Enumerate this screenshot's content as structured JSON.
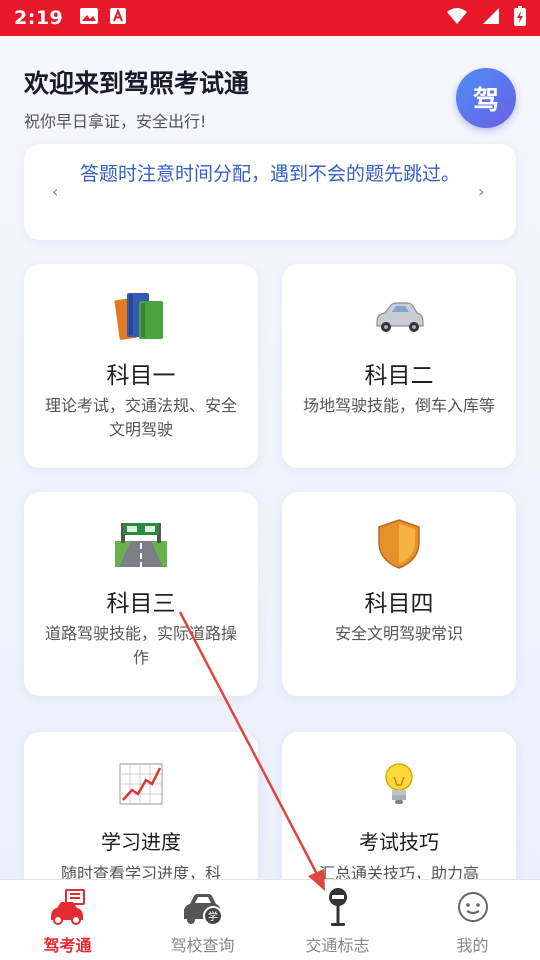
{
  "status_bar": {
    "time": "2:19",
    "left_icons": [
      "image-icon",
      "font-download-icon"
    ],
    "right_icons": [
      "wifi-icon",
      "signal-icon",
      "battery-icon"
    ],
    "color": "#e8182a"
  },
  "header": {
    "title": "欢迎来到驾照考试通",
    "subtitle": "祝你早日拿证，安全出行!",
    "avatar_text": "驾"
  },
  "tip": {
    "text": "答题时注意时间分配，遇到不会的题先跳过。",
    "prev": "‹",
    "next": "›"
  },
  "cards": [
    {
      "title": "科目一",
      "desc": "理论考试，交通法规、安全文明驾驶",
      "icon": "books-icon"
    },
    {
      "title": "科目二",
      "desc": "场地驾驶技能，倒车入库等",
      "icon": "car-icon"
    },
    {
      "title": "科目三",
      "desc": "道路驾驶技能，实际道路操作",
      "icon": "road-icon"
    },
    {
      "title": "科目四",
      "desc": "安全文明驾驶常识",
      "icon": "shield-icon"
    },
    {
      "title": "学习进度",
      "desc": "随时查看学习进度，科",
      "icon": "chart-icon"
    },
    {
      "title": "考试技巧",
      "desc": "汇总通关技巧，助力高",
      "icon": "lightbulb-icon"
    }
  ],
  "tabs": [
    {
      "label": "驾考通",
      "icon": "exam-car-icon",
      "active": true
    },
    {
      "label": "驾校查询",
      "icon": "school-car-icon",
      "active": false
    },
    {
      "label": "交通标志",
      "icon": "traffic-sign-icon",
      "active": false
    },
    {
      "label": "我的",
      "icon": "profile-face-icon",
      "active": false
    }
  ],
  "colors": {
    "accent": "#e52a33",
    "tip_text": "#3460c8",
    "avatar_gradient": [
      "#4f8ff4",
      "#6a5fe6"
    ],
    "annotation_arrow": "#e0453f"
  }
}
